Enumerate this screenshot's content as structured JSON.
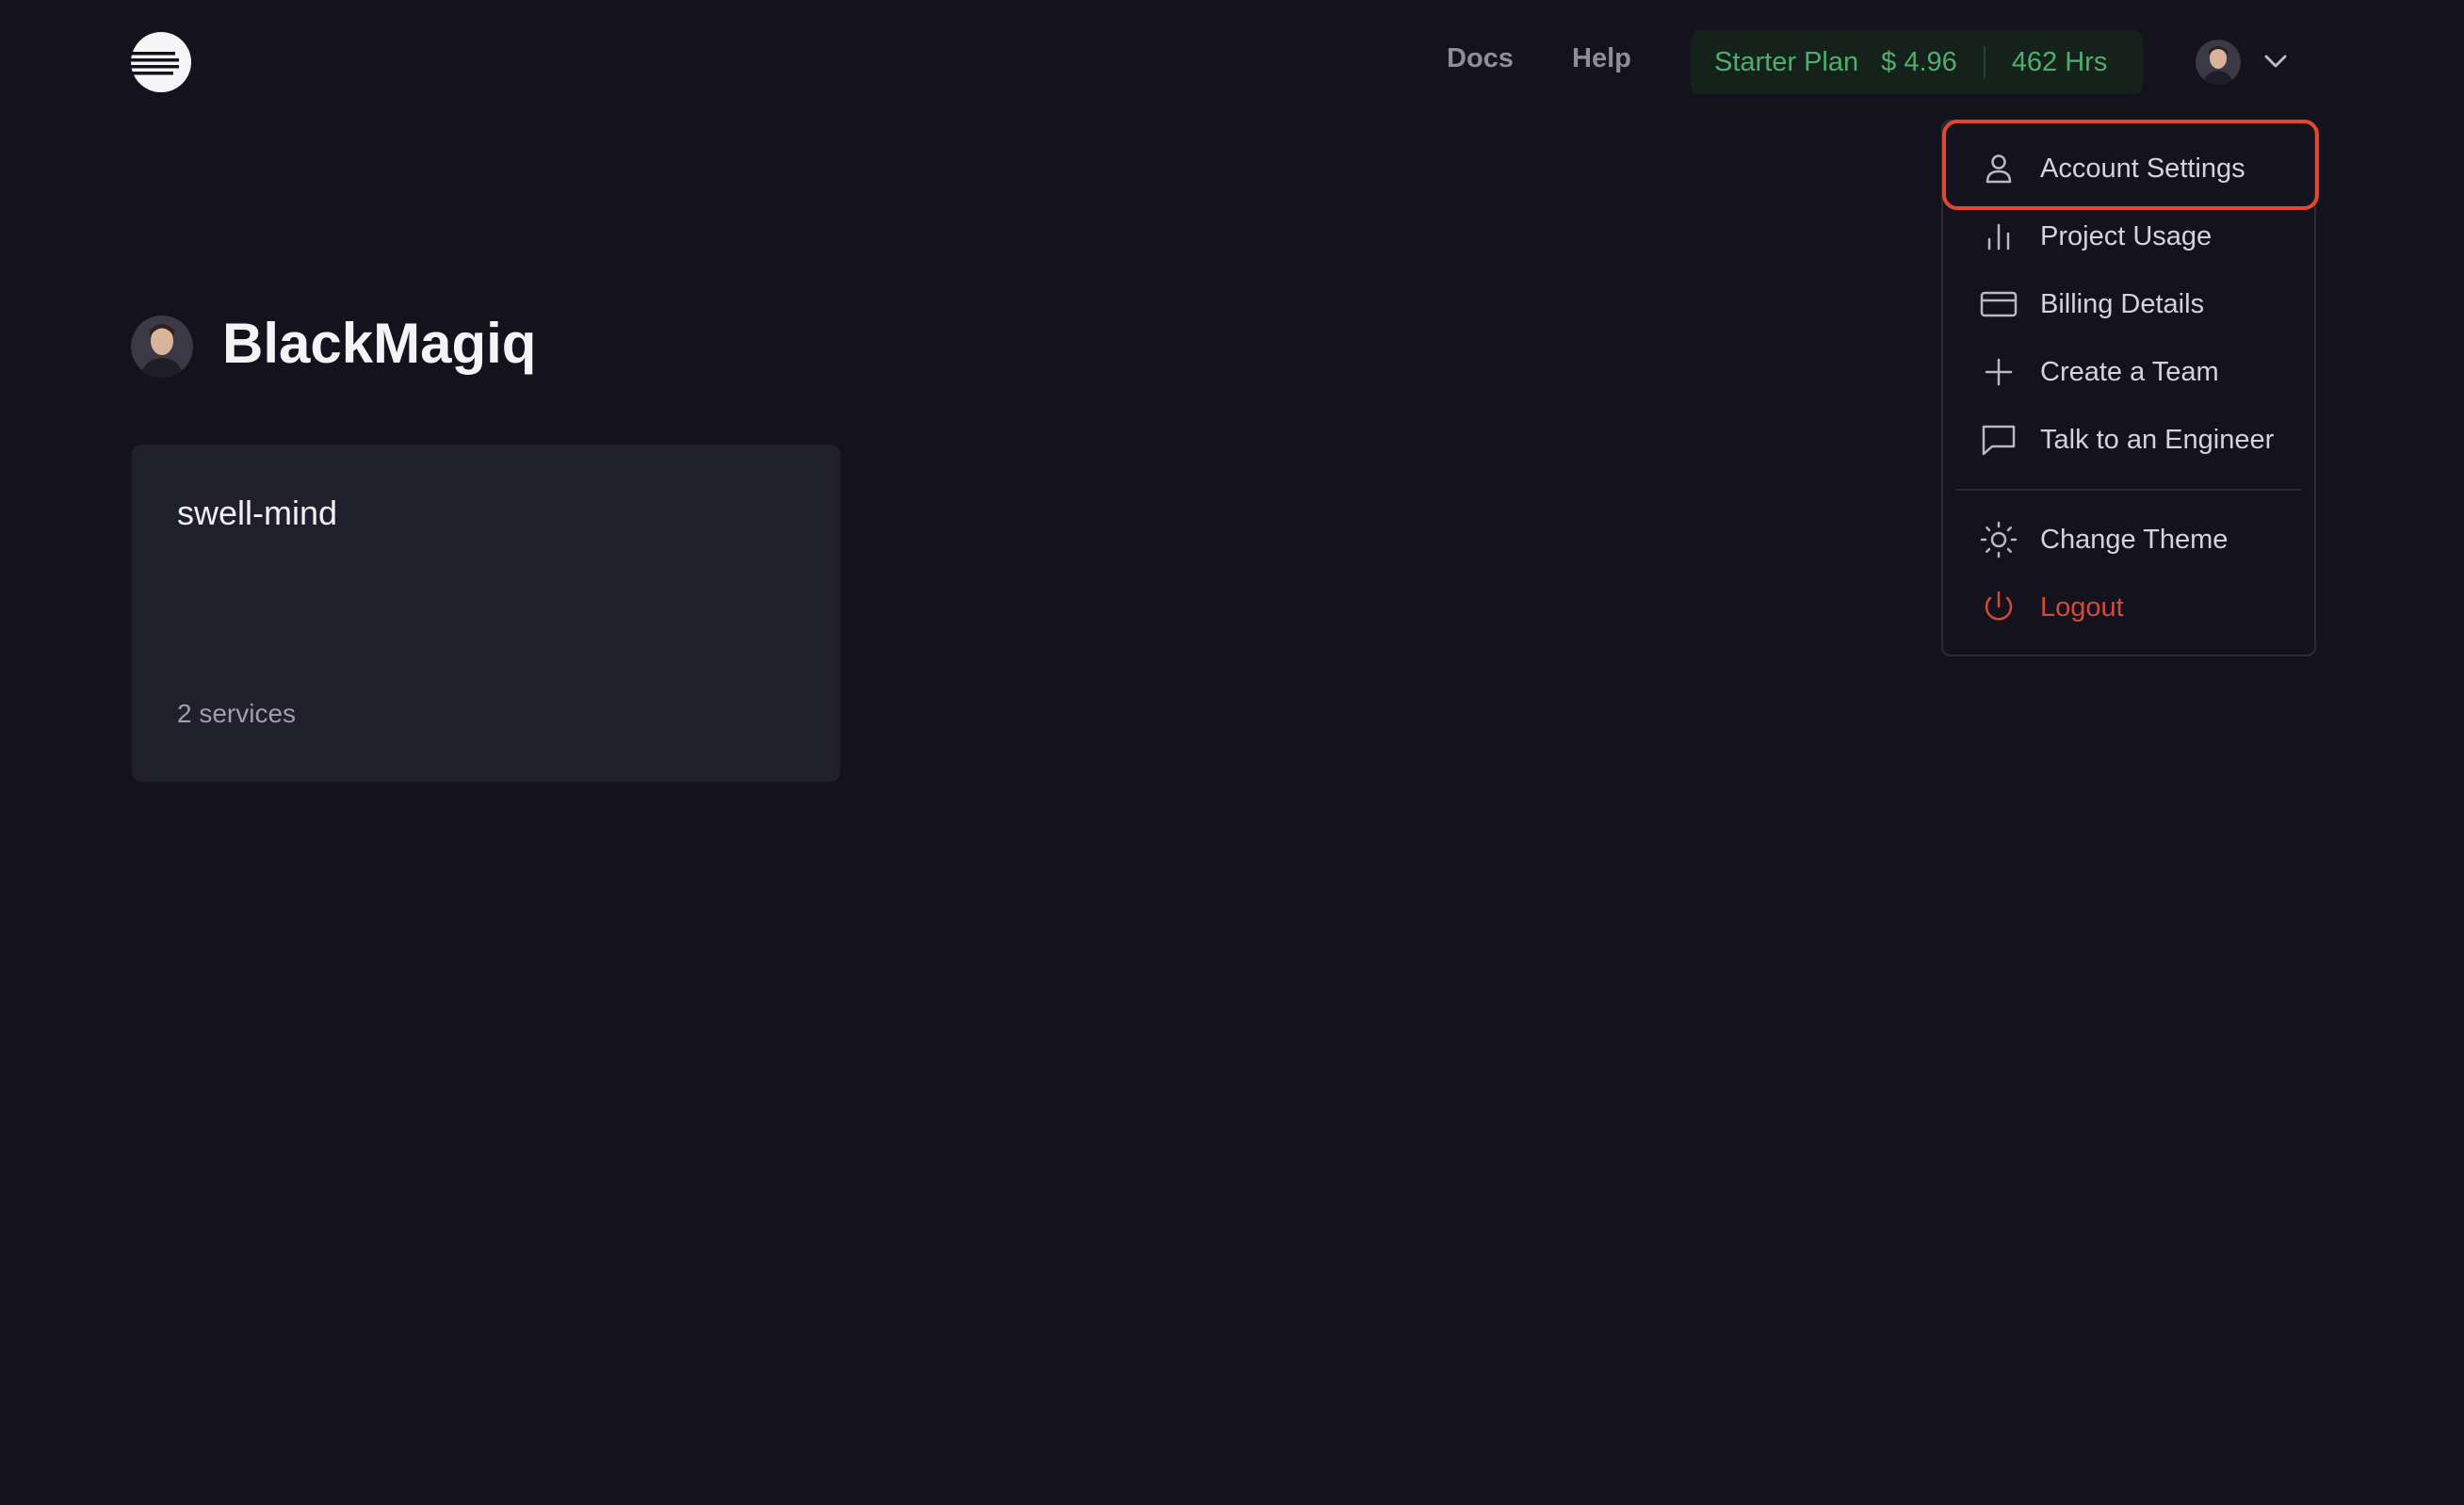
{
  "header": {
    "nav": {
      "docs": "Docs",
      "help": "Help"
    },
    "plan": {
      "name": "Starter Plan",
      "cost": "$ 4.96",
      "hours": "462 Hrs"
    }
  },
  "user_menu": {
    "items": [
      {
        "label": "Account Settings",
        "icon": "user-icon"
      },
      {
        "label": "Project Usage",
        "icon": "bar-chart-icon"
      },
      {
        "label": "Billing Details",
        "icon": "credit-card-icon"
      },
      {
        "label": "Create a Team",
        "icon": "plus-icon"
      },
      {
        "label": "Talk to an Engineer",
        "icon": "chat-bubble-icon"
      },
      {
        "label": "Change Theme",
        "icon": "sun-icon"
      },
      {
        "label": "Logout",
        "icon": "power-icon"
      }
    ]
  },
  "team": {
    "name": "BlackMagiq"
  },
  "projects": [
    {
      "name": "swell-mind",
      "services": "2 services"
    }
  ],
  "colors": {
    "background": "#13121d",
    "card": "#201f2c",
    "plan_text": "#4fae6b",
    "logout": "#d24a3c",
    "highlight": "#e2472f"
  }
}
